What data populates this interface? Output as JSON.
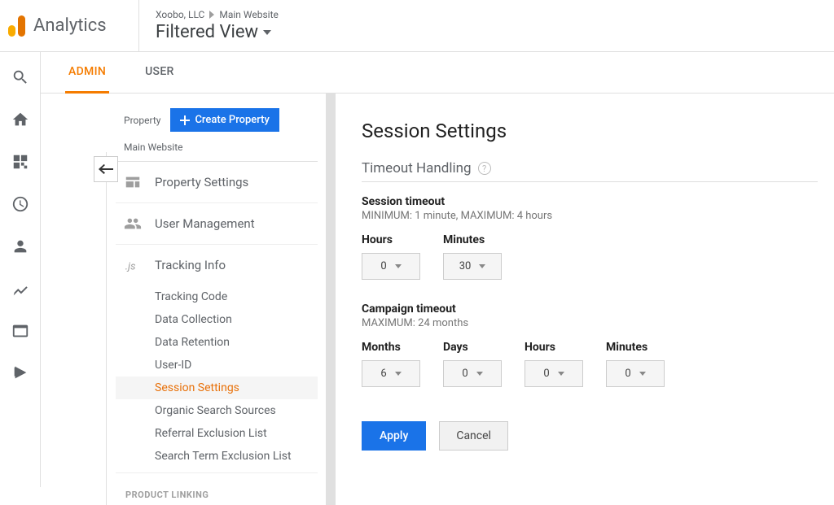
{
  "header": {
    "app_name": "Analytics",
    "breadcrumb_org": "Xoobo, LLC",
    "breadcrumb_prop": "Main Website",
    "view_name": "Filtered View"
  },
  "tabs": {
    "admin": "ADMIN",
    "user": "USER"
  },
  "property_panel": {
    "label": "Property",
    "create_btn": "Create Property",
    "selected": "Main Website",
    "items": {
      "settings": "Property Settings",
      "user_mgmt": "User Management",
      "tracking": "Tracking Info"
    },
    "tracking_children": [
      "Tracking Code",
      "Data Collection",
      "Data Retention",
      "User-ID",
      "Session Settings",
      "Organic Search Sources",
      "Referral Exclusion List",
      "Search Term Exclusion List"
    ],
    "section_product_linking": "PRODUCT LINKING"
  },
  "settings": {
    "title": "Session Settings",
    "timeout_heading": "Timeout Handling",
    "session": {
      "title": "Session timeout",
      "hint": "MINIMUM: 1 minute, MAXIMUM: 4 hours",
      "hours_label": "Hours",
      "minutes_label": "Minutes",
      "hours_value": "0",
      "minutes_value": "30"
    },
    "campaign": {
      "title": "Campaign timeout",
      "hint": "MAXIMUM: 24 months",
      "months_label": "Months",
      "days_label": "Days",
      "hours_label": "Hours",
      "minutes_label": "Minutes",
      "months_value": "6",
      "days_value": "0",
      "hours_value": "0",
      "minutes_value": "0"
    },
    "apply": "Apply",
    "cancel": "Cancel"
  }
}
